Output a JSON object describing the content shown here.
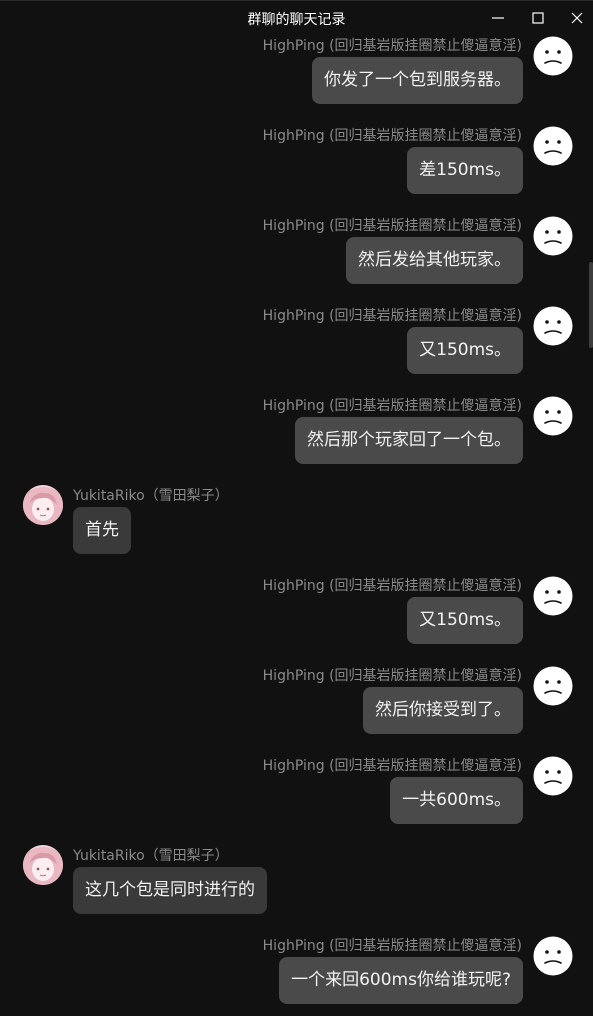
{
  "window": {
    "title": "群聊的聊天记录"
  },
  "messages": [
    {
      "side": "right",
      "sender": "HighPing (回归基岩版挂圈禁止傻逼意淫)",
      "text": "你发了一个包到服务器。"
    },
    {
      "side": "right",
      "sender": "HighPing (回归基岩版挂圈禁止傻逼意淫)",
      "text": "差150ms。"
    },
    {
      "side": "right",
      "sender": "HighPing (回归基岩版挂圈禁止傻逼意淫)",
      "text": "然后发给其他玩家。"
    },
    {
      "side": "right",
      "sender": "HighPing (回归基岩版挂圈禁止傻逼意淫)",
      "text": "又150ms。"
    },
    {
      "side": "right",
      "sender": "HighPing (回归基岩版挂圈禁止傻逼意淫)",
      "text": "然后那个玩家回了一个包。"
    },
    {
      "side": "left",
      "sender": "YukitaRiko（雪田梨子）",
      "text": "首先"
    },
    {
      "side": "right",
      "sender": "HighPing (回归基岩版挂圈禁止傻逼意淫)",
      "text": "又150ms。"
    },
    {
      "side": "right",
      "sender": "HighPing (回归基岩版挂圈禁止傻逼意淫)",
      "text": "然后你接受到了。"
    },
    {
      "side": "right",
      "sender": "HighPing (回归基岩版挂圈禁止傻逼意淫)",
      "text": "一共600ms。"
    },
    {
      "side": "left",
      "sender": "YukitaRiko（雪田梨子）",
      "text": "这几个包是同时进行的"
    },
    {
      "side": "right",
      "sender": "HighPing (回归基岩版挂圈禁止傻逼意淫)",
      "text": "一个来回600ms你给谁玩呢?"
    }
  ],
  "colors": {
    "background": "#111111",
    "bubble_self": "#4a4a4a",
    "bubble_other": "#3a3a3a",
    "sender_text": "#8a8a8a",
    "message_text": "#f2f2f2"
  },
  "icons": {
    "self_avatar": "neutral-face-icon",
    "other_avatar": "anime-girl-avatar",
    "minimize": "minimize-icon",
    "maximize": "maximize-icon",
    "close": "close-icon"
  }
}
